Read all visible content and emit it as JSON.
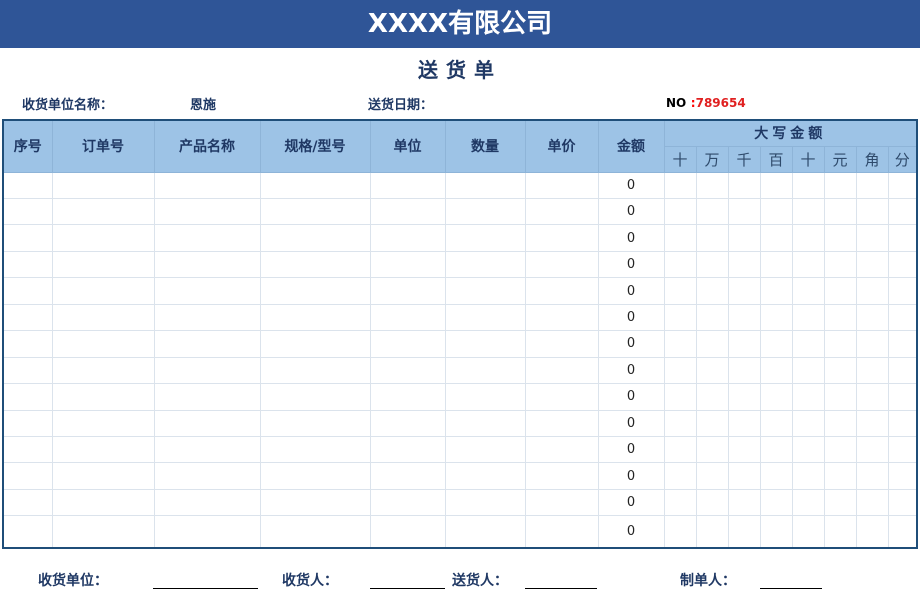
{
  "company_title": "XXXX有限公司",
  "document_title": "送货单",
  "meta": {
    "recipient_label": "收货单位名称：",
    "recipient_value": "恩施",
    "date_label": "送货日期：",
    "date_value": "",
    "no_label": "NO",
    "no_separator": ":",
    "no_value": "789654"
  },
  "table": {
    "columns": [
      "序号",
      "订单号",
      "产品名称",
      "规格/型号",
      "单位",
      "数量",
      "单价",
      "金额"
    ],
    "uppercase_group": "大写金额",
    "uppercase_digits": [
      "十",
      "万",
      "千",
      "百",
      "十",
      "元",
      "角",
      "分"
    ],
    "rows": [
      {
        "amount": "0"
      },
      {
        "amount": "0"
      },
      {
        "amount": "0"
      },
      {
        "amount": "0"
      },
      {
        "amount": "0"
      },
      {
        "amount": "0"
      },
      {
        "amount": "0"
      },
      {
        "amount": "0"
      },
      {
        "amount": "0"
      },
      {
        "amount": "0"
      },
      {
        "amount": "0"
      },
      {
        "amount": "0"
      },
      {
        "amount": "0"
      },
      {
        "amount": "0"
      }
    ]
  },
  "footer": {
    "receiving_unit_label": "收货单位：",
    "receiver_label": "收货人：",
    "sender_label": "送货人：",
    "preparer_label": "制单人："
  }
}
